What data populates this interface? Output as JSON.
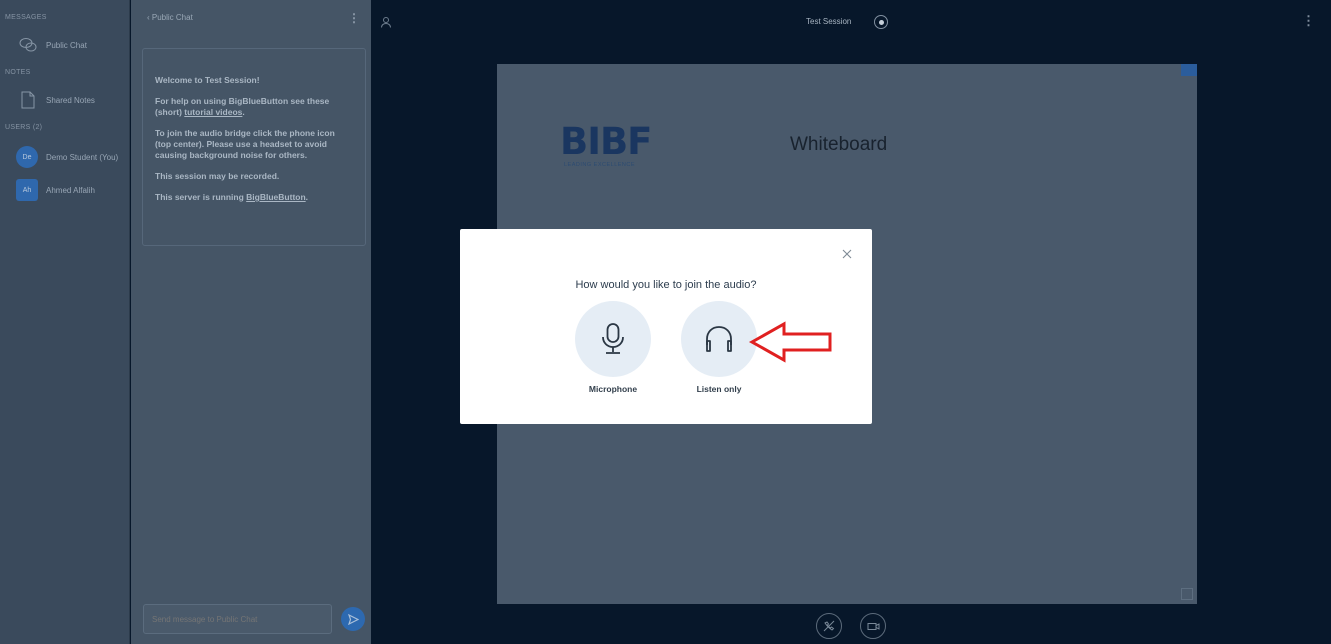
{
  "userlist": {
    "messages_title": "MESSAGES",
    "public_chat_label": "Public Chat",
    "notes_title": "NOTES",
    "shared_notes_label": "Shared Notes",
    "users_title": "USERS (2)",
    "users": [
      {
        "initials": "De",
        "name": "Demo Student (You)"
      },
      {
        "initials": "Ah",
        "name": "Ahmed Alfalih"
      }
    ]
  },
  "chat": {
    "back_label": "Public Chat",
    "welcome": {
      "line1": "Welcome to Test Session!",
      "line2_pre": "For help on using BigBlueButton see these (short) ",
      "line2_link": "tutorial videos",
      "line2_post": ".",
      "line3": "To join the audio bridge click the phone icon (top center). Please use a headset to avoid causing background noise for others.",
      "line4": "This session may be recorded.",
      "line5_pre": "This server is running ",
      "line5_link": "BigBlueButton",
      "line5_post": "."
    },
    "input_placeholder": "Send message to Public Chat"
  },
  "topbar": {
    "session_title": "Test Session"
  },
  "presentation": {
    "logo_text": "BIBF",
    "logo_subtitle": "LEADING EXCELLENCE",
    "title": "Whiteboard"
  },
  "modal": {
    "title": "How would you like to join the audio?",
    "options": [
      {
        "label": "Microphone",
        "icon": "microphone-icon"
      },
      {
        "label": "Listen only",
        "icon": "headphones-icon"
      }
    ]
  },
  "colors": {
    "accent": "#2d69b0",
    "annotation_arrow": "#e02020",
    "option_circle": "#e5edf5"
  }
}
